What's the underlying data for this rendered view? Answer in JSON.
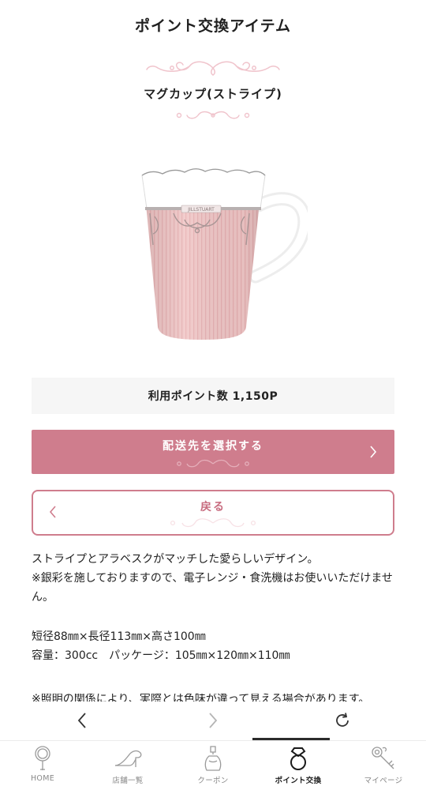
{
  "header": {
    "title": "ポイント交換アイテム"
  },
  "item": {
    "name": "マグカップ(ストライプ)",
    "image_brand_text": "JILLSTUART",
    "points_label": "利用ポイント数 1,150P"
  },
  "actions": {
    "select_shipping_label": "配送先を選択する",
    "back_label": "戻る"
  },
  "description": {
    "lines": [
      "ストライプとアラベスクがマッチした愛らしいデザイン。",
      "※銀彩を施しておりますので、電子レンジ・食洗機はお使いいただけません。"
    ],
    "specs": [
      "短径88㎜×長径113㎜×高さ100㎜",
      "容量：300cc　パッケージ：105㎜×120㎜×110㎜"
    ],
    "cutoff_line": "※照明の関係により、実際とは色味が違って見える場合があります。"
  },
  "browser_nav": {
    "back_icon": "chevron-left-icon",
    "forward_icon": "chevron-right-icon",
    "reload_icon": "reload-icon"
  },
  "tabbar": {
    "tabs": [
      {
        "label": "HOME",
        "icon": "mirror-icon",
        "active": false
      },
      {
        "label": "店舗一覧",
        "icon": "high-heel-icon",
        "active": false
      },
      {
        "label": "クーポン",
        "icon": "perfume-bottle-icon",
        "active": false
      },
      {
        "label": "ポイント交換",
        "icon": "ring-icon",
        "active": true
      },
      {
        "label": "マイページ",
        "icon": "key-icon",
        "active": false
      }
    ]
  },
  "colors": {
    "accent": "#cf7d8d",
    "accent_text": "#c86d80",
    "ornament": "#f0c4cc",
    "points_bg": "#f6f6f6",
    "mug_pink": "#f1c7c7"
  }
}
